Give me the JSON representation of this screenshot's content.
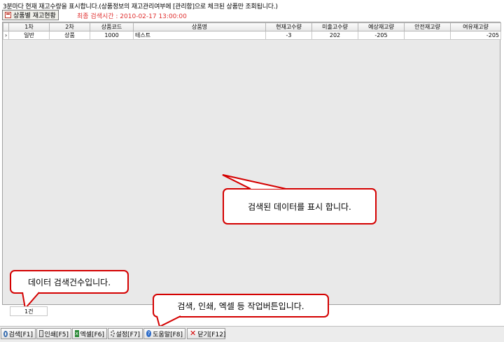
{
  "info_text": "3분마다 현재 재고수량을 표시합니다.(상품정보의 재고관리여부에 [관리함]으로 체크된 상품만 조회됩니다.)",
  "tab": {
    "label": "상품별 재고현황"
  },
  "last_search": "최종 검색시간 : 2010-02-17 13:00:00",
  "table": {
    "columns": [
      "1차",
      "2차",
      "상품코드",
      "상품명",
      "현재고수량",
      "미출고수량",
      "예상재고량",
      "안전재고량",
      "여유재고량"
    ],
    "rows": [
      {
        "indicator": "›",
        "cells": [
          "일반",
          "상품",
          "1000",
          "테스트",
          "-3",
          "202",
          "-205",
          "",
          "-205"
        ]
      }
    ]
  },
  "count_text": "1건",
  "callouts": {
    "data": "검색된 데이터를 표시 합니다.",
    "count": "데이터 검색건수입니다.",
    "buttons": "검색, 인쇄, 엑셀 등 작업버튼입니다."
  },
  "toolbar": {
    "search": "검색[F1]",
    "print": "인쇄[F5]",
    "excel": "엑셀[F6]",
    "settings": "설정[F7]",
    "help": "도움말[F8]",
    "close": "닫기[F12]"
  },
  "colors": {
    "callout_border": "#d40000",
    "last_search": "#e03030"
  }
}
